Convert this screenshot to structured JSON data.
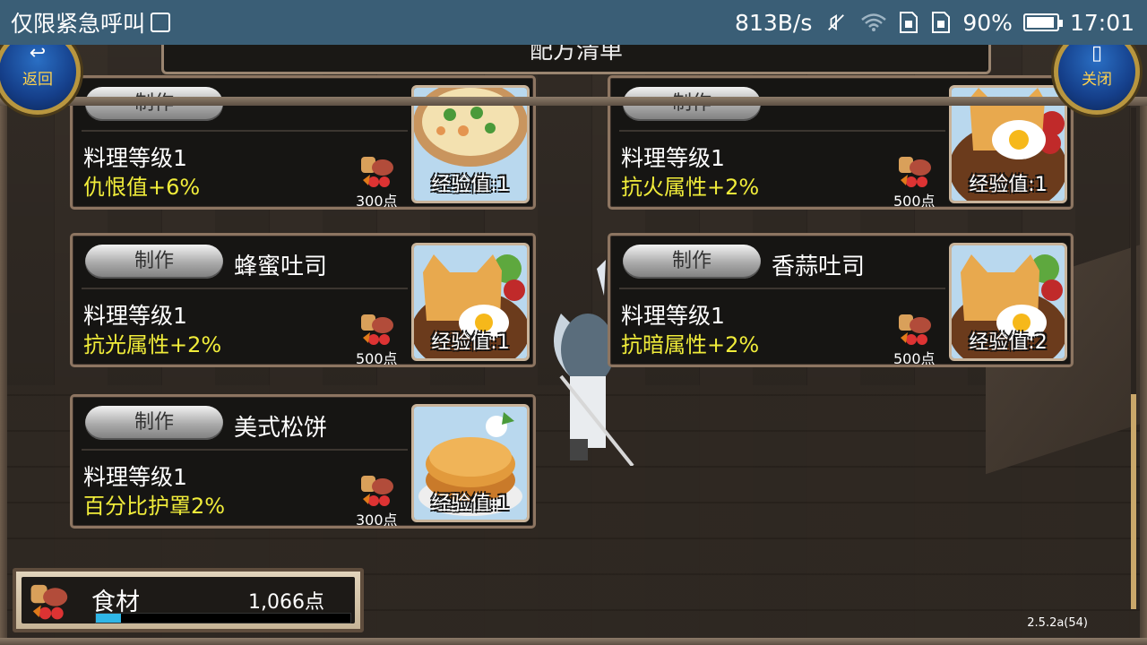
{
  "status_bar": {
    "carrier": "仅限紧急呼叫",
    "speed": "813B/s",
    "battery": "90%",
    "time": "17:01"
  },
  "header": {
    "title": "配方清单",
    "back_label": "返回",
    "close_label": "关闭"
  },
  "recipes": [
    {
      "button": "制作",
      "name": "",
      "level": "料理等级1",
      "bonus": "仇恨值+6%",
      "cost": "300点",
      "exp": "经验值:1",
      "image": "soup-icon"
    },
    {
      "button": "制作",
      "name": "",
      "level": "料理等级1",
      "bonus": "抗火属性+2%",
      "cost": "500点",
      "exp": "经验值:1",
      "image": "toast-icon"
    },
    {
      "button": "制作",
      "name": "蜂蜜吐司",
      "level": "料理等级1",
      "bonus": "抗光属性+2%",
      "cost": "500点",
      "exp": "经验值:1",
      "image": "toast-icon"
    },
    {
      "button": "制作",
      "name": "香蒜吐司",
      "level": "料理等级1",
      "bonus": "抗暗属性+2%",
      "cost": "500点",
      "exp": "经验值:2",
      "image": "toast-icon"
    },
    {
      "button": "制作",
      "name": "美式松饼",
      "level": "料理等级1",
      "bonus": "百分比护罩2%",
      "cost": "300点",
      "exp": "经验值:1",
      "image": "pancake-icon"
    }
  ],
  "ingredients": {
    "label": "食材",
    "amount": "1,066点",
    "fill_fraction": 0.1
  },
  "version": "2.5.2a(54)",
  "colors": {
    "status_bar": "#3a5e76",
    "bonus_text": "#f0ec3a",
    "card_border": "#8d7561",
    "bar_fill": "#2fb6e6"
  }
}
